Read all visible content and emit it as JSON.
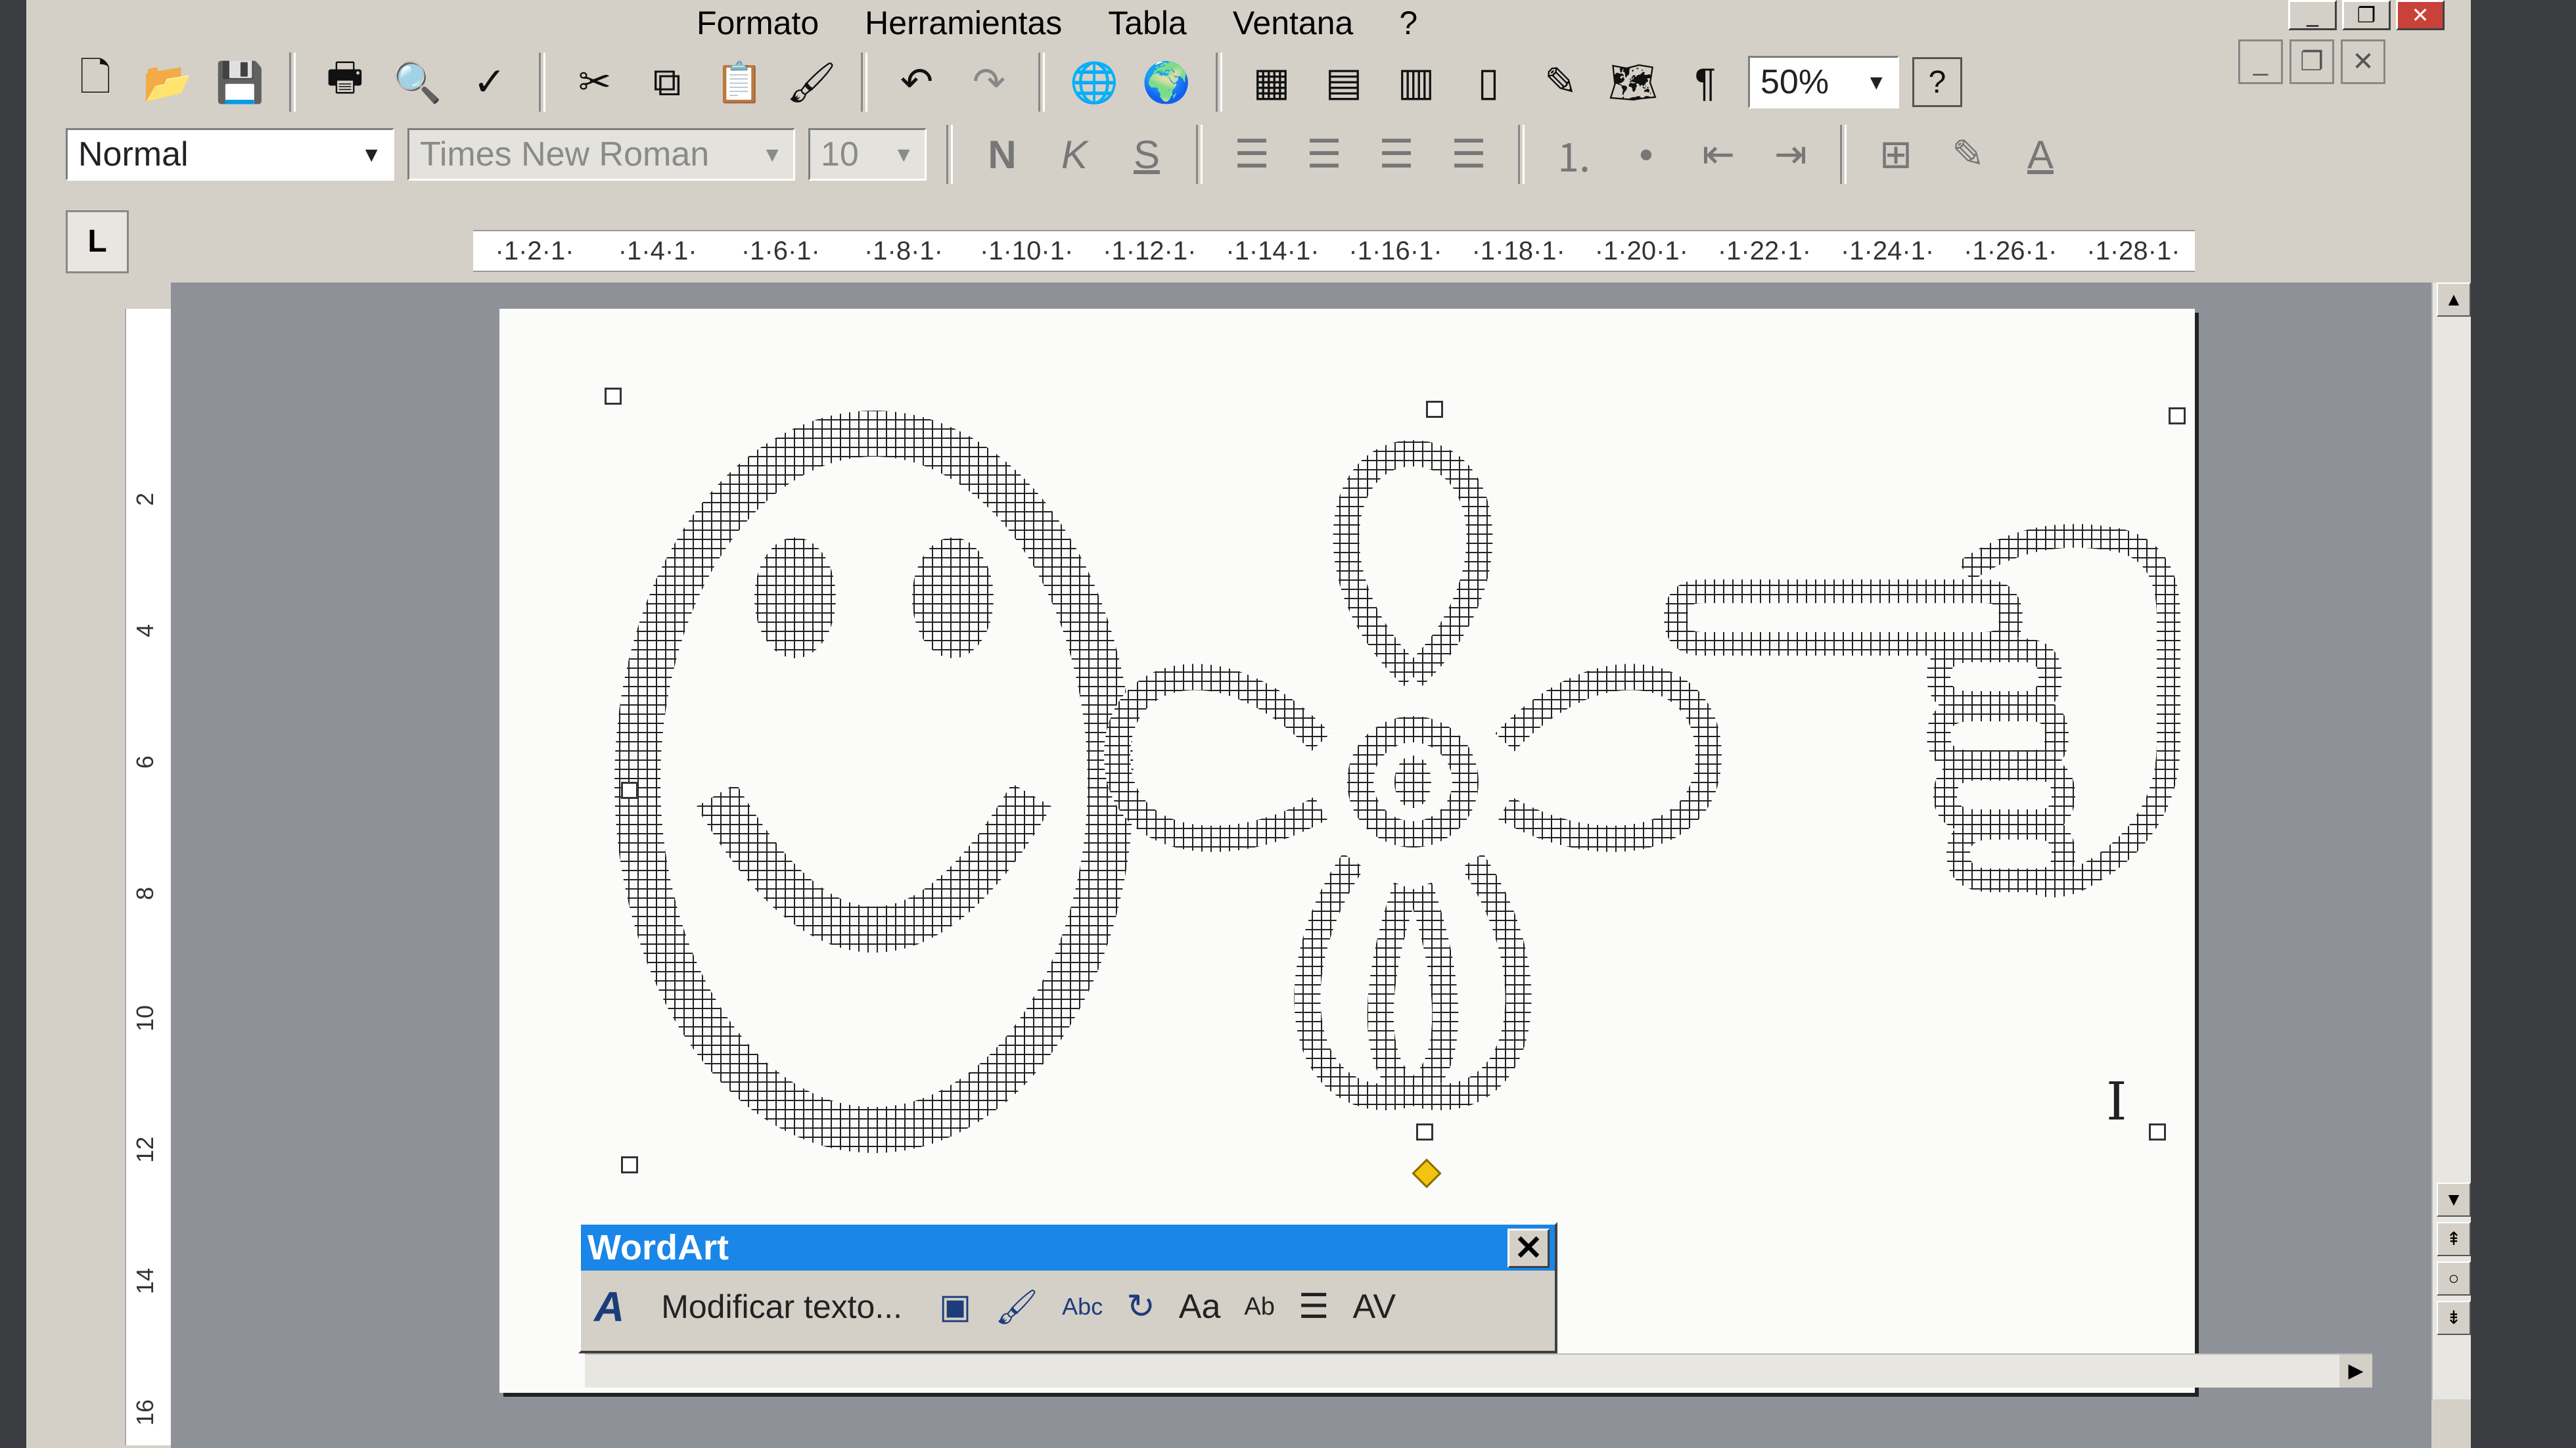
{
  "menubar": {
    "items": [
      "Formato",
      "Herramientas",
      "Tabla",
      "Ventana",
      "?"
    ]
  },
  "window_controls": {
    "minimize": "_",
    "restore": "❐",
    "close": "✕"
  },
  "doc_controls": {
    "minimize": "_",
    "restore": "❐",
    "close": "✕"
  },
  "toolbar_standard": {
    "zoom": "50%",
    "help": "?"
  },
  "toolbar_format": {
    "style": "Normal",
    "font": "Times New Roman",
    "size": "10",
    "bold": "N",
    "italic": "K",
    "underline": "S",
    "font_color_letter": "A"
  },
  "ruler": {
    "corner": "L",
    "ticks": [
      "2",
      "4",
      "6",
      "8",
      "10",
      "12",
      "14",
      "16",
      "18",
      "20",
      "22",
      "24",
      "26",
      "28"
    ]
  },
  "vertical_ruler": {
    "ticks": [
      "2",
      "4",
      "6",
      "8",
      "10",
      "12",
      "14",
      "16"
    ]
  },
  "wordart_toolbar": {
    "title": "WordArt",
    "close": "✕",
    "edit_text": "Modificar texto...",
    "icons": [
      "insert-wordart-icon",
      "wordart-gallery-icon",
      "format-wordart-icon",
      "wordart-shape-icon",
      "free-rotate-icon",
      "same-height-icon",
      "vertical-text-icon",
      "alignment-icon",
      "character-spacing-icon"
    ],
    "labels": {
      "same_height": "Aa",
      "vertical": "Ab",
      "spacing": "AV",
      "abc": "Abc"
    }
  },
  "colors": {
    "wordart_title": "#1a86e8",
    "workspace": "#8e9198",
    "page": "#fbfcfa",
    "shape_pattern": "#222222",
    "adjust_handle": "#f2c40f"
  }
}
